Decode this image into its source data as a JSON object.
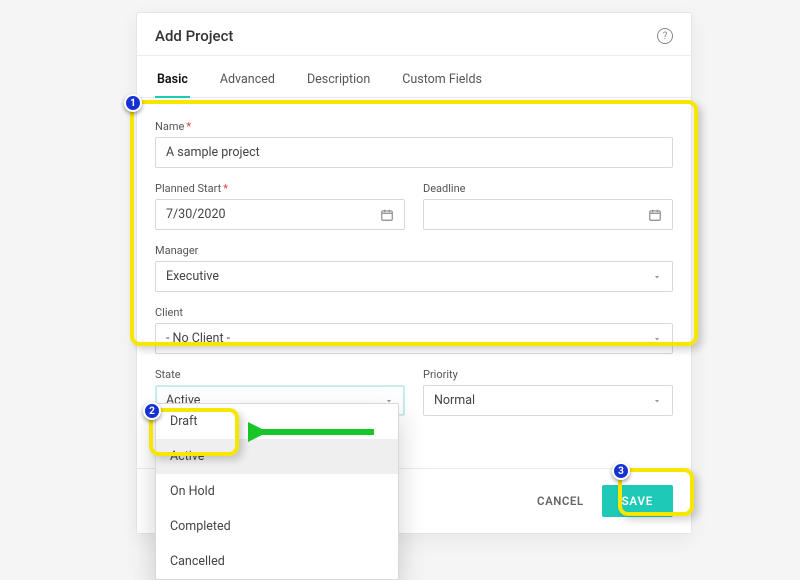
{
  "header": {
    "title": "Add Project"
  },
  "tabs": [
    "Basic",
    "Advanced",
    "Description",
    "Custom Fields"
  ],
  "form": {
    "name": {
      "label": "Name",
      "value": "A sample project"
    },
    "planned_start": {
      "label": "Planned Start",
      "value": "7/30/2020"
    },
    "deadline": {
      "label": "Deadline",
      "value": ""
    },
    "manager": {
      "label": "Manager",
      "value": "Executive"
    },
    "client": {
      "label": "Client",
      "value": "- No Client -"
    },
    "state": {
      "label": "State",
      "value": "Active"
    },
    "priority": {
      "label": "Priority",
      "value": "Normal"
    }
  },
  "state_options": [
    "Draft",
    "Active",
    "On Hold",
    "Completed",
    "Cancelled"
  ],
  "buttons": {
    "cancel": "CANCEL",
    "save": "SAVE"
  },
  "annotations": {
    "b1": "1",
    "b2": "2",
    "b3": "3"
  }
}
